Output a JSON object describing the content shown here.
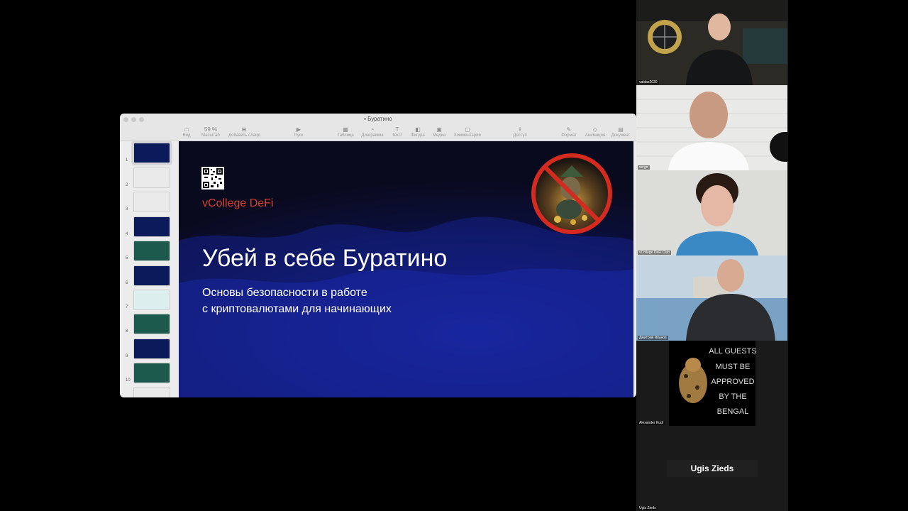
{
  "window": {
    "title": "Буратино",
    "toolbar": [
      {
        "label": "Вид",
        "icon": "sidebar-icon"
      },
      {
        "label": "Масштаб",
        "icon": "zoom-icon",
        "value": "59 %"
      },
      {
        "label": "Добавить слайд",
        "icon": "add-slide-icon"
      },
      {
        "label": "Пуск",
        "icon": "play-icon"
      },
      {
        "label": "Таблица",
        "icon": "table-icon"
      },
      {
        "label": "Диаграмма",
        "icon": "chart-icon"
      },
      {
        "label": "Текст",
        "icon": "text-icon"
      },
      {
        "label": "Фигура",
        "icon": "shape-icon"
      },
      {
        "label": "Медиа",
        "icon": "media-icon"
      },
      {
        "label": "Комментарий",
        "icon": "comment-icon"
      },
      {
        "label": "Доступ",
        "icon": "share-icon"
      },
      {
        "label": "Формат",
        "icon": "format-icon"
      },
      {
        "label": "Анимация",
        "icon": "animate-icon"
      },
      {
        "label": "Документ",
        "icon": "document-icon"
      }
    ]
  },
  "navigator": {
    "numbers": [
      "1",
      "2",
      "3",
      "4",
      "5",
      "6",
      "7",
      "8",
      "9",
      "10"
    ]
  },
  "slide": {
    "brand": "vCollege DeFi",
    "title": "Убей в себе Буратино",
    "subtitle_line1": "Основы безопасности в работе",
    "subtitle_line2": "с криптовалютами для начинающих"
  },
  "participants": [
    {
      "name": "valdas2020"
    },
    {
      "name": "sergo"
    },
    {
      "name": "vCollege DeFi Club"
    },
    {
      "name": "Дмитрий Иванов"
    },
    {
      "name": "Alexander Kudr",
      "poster_text": [
        "ALL GUESTS",
        "MUST BE",
        "APPROVED",
        "BY THE",
        "BENGAL"
      ]
    },
    {
      "name": "Ugis Zieds",
      "display": "Ugis Zieds"
    }
  ],
  "colors": {
    "brand_red": "#d8402e",
    "slide_bg": "#0a0f3a",
    "panel_bg": "#1a1a1a"
  }
}
